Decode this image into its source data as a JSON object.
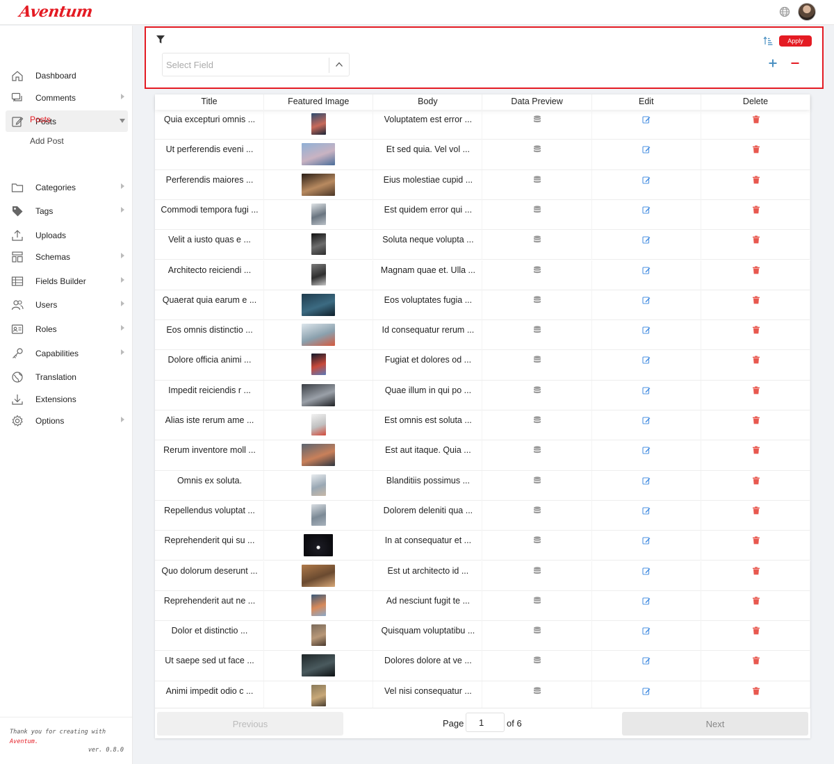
{
  "app": {
    "brand": "Aventum"
  },
  "sidebar": {
    "items": [
      {
        "label": "Dashboard",
        "icon": "home-icon",
        "arrow": false
      },
      {
        "label": "Comments",
        "icon": "comments-icon",
        "arrow": true
      },
      {
        "label": "Posts",
        "icon": "edit-icon",
        "arrow": true,
        "expanded": true
      },
      {
        "label": "Categories",
        "icon": "folder-icon",
        "arrow": true
      },
      {
        "label": "Tags",
        "icon": "tag-icon",
        "arrow": true
      },
      {
        "label": "Uploads",
        "icon": "upload-icon",
        "arrow": false
      },
      {
        "label": "Schemas",
        "icon": "layout-icon",
        "arrow": true
      },
      {
        "label": "Fields Builder",
        "icon": "table-icon",
        "arrow": true
      },
      {
        "label": "Users",
        "icon": "users-icon",
        "arrow": true
      },
      {
        "label": "Roles",
        "icon": "id-card-icon",
        "arrow": true
      },
      {
        "label": "Capabilities",
        "icon": "key-icon",
        "arrow": true
      },
      {
        "label": "Translation",
        "icon": "globe-icon",
        "arrow": false
      },
      {
        "label": "Extensions",
        "icon": "download-icon",
        "arrow": false
      },
      {
        "label": "Options",
        "icon": "gear-icon",
        "arrow": true
      }
    ],
    "sub_items": [
      {
        "label": "Posts",
        "current": true
      },
      {
        "label": "Add Post",
        "current": false
      }
    ],
    "footer": {
      "thanks": "Thank you for creating with",
      "brand": "Aventum.",
      "version": "ver. 0.8.0"
    }
  },
  "filter": {
    "select_placeholder": "Select Field",
    "apply_label": "Apply"
  },
  "table": {
    "columns": [
      "Title",
      "Featured Image",
      "Body",
      "Data Preview",
      "Edit",
      "Delete"
    ],
    "rows": [
      {
        "title": "Quia excepturi omnis ...",
        "body": "Voluptatem est error ...",
        "thumb": "portrait",
        "colors": [
          "#2b4a6e",
          "#c86a5a",
          "#1a2638"
        ]
      },
      {
        "title": "Ut perferendis eveni ...",
        "body": "Et sed quia. Vel vol ...",
        "thumb": "landscape",
        "colors": [
          "#8fb0d6",
          "#c9b3c2",
          "#4b6e9a"
        ]
      },
      {
        "title": "Perferendis maiores ...",
        "body": "Eius molestiae cupid ...",
        "thumb": "landscape",
        "colors": [
          "#2a1e16",
          "#b88a60",
          "#4a3626"
        ]
      },
      {
        "title": "Commodi tempora fugi ...",
        "body": "Est quidem error qui ...",
        "thumb": "portrait",
        "colors": [
          "#dfe3e6",
          "#6a7580",
          "#b9c0c7"
        ]
      },
      {
        "title": "Velit a iusto quas e ...",
        "body": "Soluta neque volupta ...",
        "thumb": "portrait",
        "colors": [
          "#111",
          "#6d6d6d",
          "#2e2e2e"
        ]
      },
      {
        "title": "Architecto reiciendi ...",
        "body": "Magnam quae et. Ulla ...",
        "thumb": "portrait",
        "colors": [
          "#7a7a7a",
          "#2f2f2f",
          "#c5c5c5"
        ]
      },
      {
        "title": "Quaerat quia earum e ...",
        "body": "Eos voluptates fugia ...",
        "thumb": "landscape",
        "colors": [
          "#1f3b4d",
          "#3c6b82",
          "#0f1f2a"
        ]
      },
      {
        "title": "Eos omnis distinctio ...",
        "body": "Id consequatur rerum ...",
        "thumb": "landscape",
        "colors": [
          "#dde6ec",
          "#8aa0ad",
          "#d65a3e"
        ]
      },
      {
        "title": "Dolore officia animi ...",
        "body": "Fugiat et dolores od ...",
        "thumb": "portrait",
        "colors": [
          "#10182a",
          "#c84a3a",
          "#5a7ab8"
        ]
      },
      {
        "title": "Impedit reiciendis r ...",
        "body": "Quae illum in qui po ...",
        "thumb": "landscape",
        "colors": [
          "#3a3e44",
          "#9aa0a8",
          "#1e2024"
        ]
      },
      {
        "title": "Alias iste rerum ame ...",
        "body": "Est omnis est soluta ...",
        "thumb": "portrait",
        "colors": [
          "#f2f2f2",
          "#c0c0c0",
          "#d24a3a"
        ]
      },
      {
        "title": "Rerum inventore moll ...",
        "body": "Est aut itaque. Quia ...",
        "thumb": "landscape",
        "colors": [
          "#5a6470",
          "#c9805a",
          "#2e3640"
        ]
      },
      {
        "title": "Omnis ex soluta.",
        "body": "Blanditiis possimus ...",
        "thumb": "portrait",
        "colors": [
          "#e8ecef",
          "#9aa8b4",
          "#c7b8a8"
        ]
      },
      {
        "title": "Repellendus voluptat ...",
        "body": "Dolorem deleniti qua ...",
        "thumb": "portrait",
        "colors": [
          "#d8dde2",
          "#7c8a96",
          "#a8b2bc"
        ]
      },
      {
        "title": "Reprehenderit qui su ...",
        "body": "In at consequatur et ...",
        "thumb": "landscape-dark",
        "colors": [
          "#0c0c10",
          "#1a1a22",
          "#f4f4f4"
        ]
      },
      {
        "title": "Quo dolorum deserunt ...",
        "body": "Est ut architecto id ...",
        "thumb": "landscape",
        "colors": [
          "#b07a4a",
          "#6a4a30",
          "#d8a878"
        ]
      },
      {
        "title": "Reprehenderit aut ne ...",
        "body": "Ad nesciunt fugit te ...",
        "thumb": "portrait",
        "colors": [
          "#3a5a7a",
          "#d88a5a",
          "#8aa8c8"
        ]
      },
      {
        "title": "Dolor et distinctio ...",
        "body": "Quisquam voluptatibu ...",
        "thumb": "portrait",
        "colors": [
          "#7a6a5a",
          "#b89878",
          "#4a3a2e"
        ]
      },
      {
        "title": "Ut saepe sed ut face ...",
        "body": "Dolores dolore at ve ...",
        "thumb": "landscape",
        "colors": [
          "#1e2628",
          "#4a5a5e",
          "#0e1214"
        ]
      },
      {
        "title": "Animi impedit odio c ...",
        "body": "Vel nisi consequatur ...",
        "thumb": "portrait",
        "colors": [
          "#8a7a5a",
          "#c8a878",
          "#4a3e30"
        ]
      }
    ]
  },
  "pagination": {
    "previous_label": "Previous",
    "page_label": "Page",
    "current_page": "1",
    "of_label": "of 6",
    "next_label": "Next"
  },
  "colors": {
    "accent": "#e41b23",
    "edit_icon": "#4a90e2",
    "delete_icon": "#e8584f",
    "data_icon": "#9a9a9a"
  }
}
